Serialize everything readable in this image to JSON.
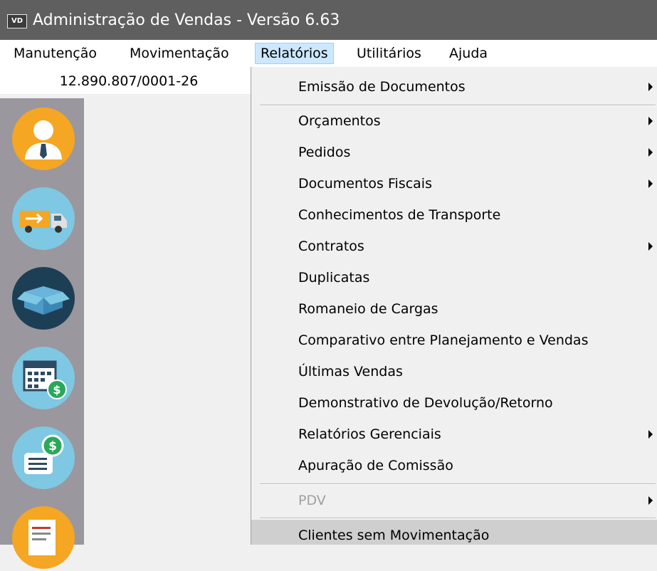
{
  "window": {
    "app_icon": "VD",
    "title": "Administração de Vendas - Versão 6.63"
  },
  "menubar": {
    "items": [
      {
        "label": "Manutenção"
      },
      {
        "label": "Movimentação"
      },
      {
        "label": "Relatórios"
      },
      {
        "label": "Utilitários"
      },
      {
        "label": "Ajuda"
      }
    ]
  },
  "company": {
    "cnpj": "12.890.807/0001-26"
  },
  "sidebar": {
    "icons": [
      "person-tie-icon",
      "delivery-truck-icon",
      "open-box-icon",
      "calendar-money-icon",
      "document-money-icon",
      "certificate-scroll-icon"
    ]
  },
  "reports_menu": {
    "items": [
      {
        "label": "Emissão de Documentos",
        "submenu": true
      },
      {
        "label": "Orçamentos",
        "submenu": true
      },
      {
        "label": "Pedidos",
        "submenu": true
      },
      {
        "label": "Documentos Fiscais",
        "submenu": true
      },
      {
        "label": "Conhecimentos de Transporte",
        "submenu": false
      },
      {
        "label": "Contratos",
        "submenu": true
      },
      {
        "label": "Duplicatas",
        "submenu": false
      },
      {
        "label": "Romaneio de Cargas",
        "submenu": false
      },
      {
        "label": "Comparativo entre Planejamento e Vendas",
        "submenu": false
      },
      {
        "label": "Últimas Vendas",
        "submenu": false
      },
      {
        "label": "Demonstrativo de Devolução/Retorno",
        "submenu": false
      },
      {
        "label": "Relatórios Gerenciais",
        "submenu": true
      },
      {
        "label": "Apuração de Comissão",
        "submenu": false
      },
      {
        "label": "PDV",
        "submenu": true,
        "disabled": true
      },
      {
        "label": "Clientes sem Movimentação",
        "submenu": false
      }
    ]
  },
  "colors": {
    "titlebar": "#5f5f5f",
    "menu_active": "#cce8ff",
    "sidebar": "#9a979e",
    "hover_item": "#cfcfcf"
  }
}
